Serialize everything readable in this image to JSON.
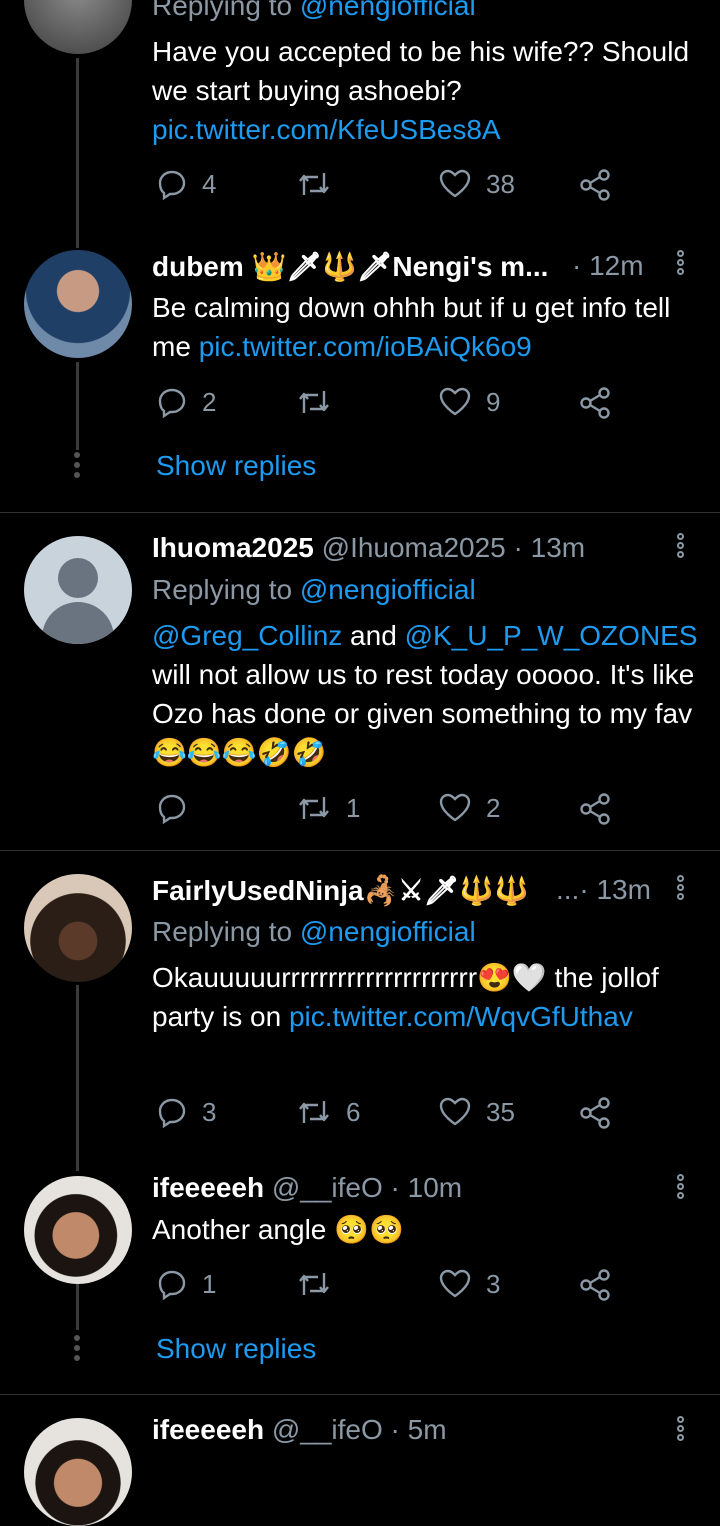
{
  "tweets": [
    {
      "id": "t0",
      "replying_prefix": "Replying to ",
      "replying_handle": "@nengiofficial",
      "text": "Have you accepted to be his wife?? Should we start buying ashoebi?",
      "link": "pic.twitter.com/KfeUSBes8A",
      "replies": "4",
      "retweets": "",
      "likes": "38"
    },
    {
      "id": "t1",
      "name": "dubem 👑🗡🔱🗡Nengi's m...",
      "time": "· 12m",
      "text": "Be calming down ohhh but if u get info tell me ",
      "link": "pic.twitter.com/ioBAiQk6o9",
      "replies": "2",
      "retweets": "",
      "likes": "9",
      "show_replies": "Show replies"
    },
    {
      "id": "t2",
      "name": "Ihuoma2025",
      "handle_time": "@Ihuoma2025 · 13m",
      "replying_prefix": "Replying to ",
      "replying_handle": "@nengiofficial",
      "mention1": "@Greg_Collinz",
      "and_text": " and ",
      "mention2": "@K_U_P_W_OZONES",
      "text": "will not allow us to rest today ooooo. It's like Ozo has done or given something to my fav 😂😂😂🤣🤣",
      "replies": "",
      "retweets": "1",
      "likes": "2"
    },
    {
      "id": "t3",
      "name": "FairlyUsedNinja🦂⚔🗡🔱🔱",
      "handle_time": "...· 13m",
      "replying_prefix": "Replying to ",
      "replying_handle": "@nengiofficial",
      "text": "Okauuuuurrrrrrrrrrrrrrrrrrrrr😍🤍 the jollof party is on ",
      "link": "pic.twitter.com/WqvGfUthav",
      "replies": "3",
      "retweets": "6",
      "likes": "35"
    },
    {
      "id": "t4",
      "name": "ifeeeeeh",
      "handle_time": "@__ifeO · 10m",
      "text": "Another angle 🥺🥺",
      "replies": "1",
      "retweets": "",
      "likes": "3",
      "show_replies": "Show replies"
    },
    {
      "id": "t5",
      "name": "ifeeeeeh",
      "handle_time": "@__ifeO · 5m"
    }
  ],
  "icons": {
    "reply": "reply-icon",
    "retweet": "retweet-icon",
    "like": "heart-icon",
    "share": "share-icon",
    "more": "more-options-icon"
  },
  "colors": {
    "background": "#000000",
    "link": "#1d9bf0",
    "muted": "#8b98a5",
    "divider": "#2f3336"
  }
}
